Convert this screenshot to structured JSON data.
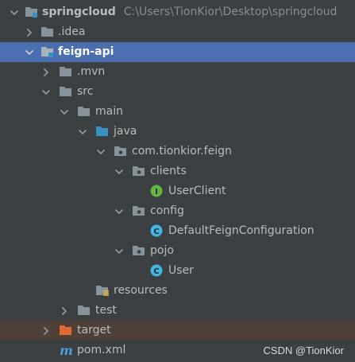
{
  "tree": {
    "root": {
      "label": "springcloud",
      "path": "C:\\Users\\TionKior\\Desktop\\springcloud"
    },
    "idea": {
      "label": ".idea"
    },
    "feign_api": {
      "label": "feign-api"
    },
    "mvn": {
      "label": ".mvn"
    },
    "src": {
      "label": "src"
    },
    "main": {
      "label": "main"
    },
    "java": {
      "label": "java"
    },
    "package": {
      "label": "com.tionkior.feign"
    },
    "clients": {
      "label": "clients"
    },
    "user_client": {
      "label": "UserClient",
      "icon_letter": "I"
    },
    "config": {
      "label": "config"
    },
    "default_feign_configuration": {
      "label": "DefaultFeignConfiguration",
      "icon_letter": "C"
    },
    "pojo": {
      "label": "pojo"
    },
    "user": {
      "label": "User",
      "icon_letter": "C"
    },
    "resources": {
      "label": "resources"
    },
    "test": {
      "label": "test"
    },
    "target": {
      "label": "target"
    },
    "pom": {
      "label": "pom.xml",
      "icon_letter": "m"
    }
  },
  "watermark": "CSDN @TionKior",
  "colors": {
    "background": "#3c3f41",
    "selection": "#4b6eaf",
    "excluded": "#4e4036",
    "folder": "#87939a",
    "source_folder": "#3592c4",
    "excluded_folder": "#e06a33",
    "interface": "#62b543",
    "class": "#40b6e0"
  }
}
